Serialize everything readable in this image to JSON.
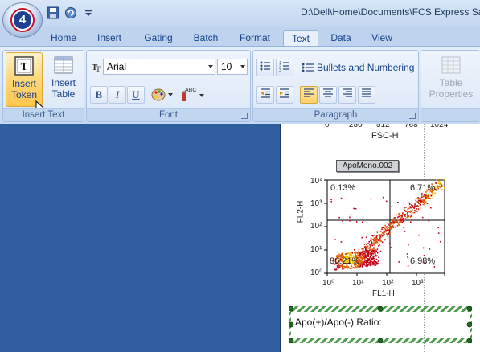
{
  "window": {
    "title": "D:\\Dell\\Home\\Documents\\FCS Express Sa"
  },
  "app_logo": {
    "text": "4"
  },
  "quick_access": {
    "items": [
      "save-icon",
      "undo-icon",
      "customize-dropdown-icon"
    ]
  },
  "tabs": [
    "Home",
    "Insert",
    "Gating",
    "Batch",
    "Format",
    "Text",
    "Data",
    "View"
  ],
  "active_tab": "Text",
  "ribbon": {
    "insert_text": {
      "label": "Insert Text",
      "insert_token": "Insert Token",
      "insert_token_line1": "Insert",
      "insert_token_line2": "Token",
      "insert_table_line1": "Insert",
      "insert_table_line2": "Table"
    },
    "font": {
      "label": "Font",
      "font_name": "Arial",
      "font_size": "10",
      "bold": "B",
      "italic": "I",
      "underline": "U"
    },
    "paragraph": {
      "label": "Paragraph",
      "bullets_numbering": "Bullets and Numbering"
    },
    "table_properties": {
      "line1": "Table",
      "line2": "Properties"
    }
  },
  "document": {
    "top_axis_label": "FSC-H",
    "top_axis_ticks": [
      "0",
      "250",
      "512",
      "768",
      "1024"
    ],
    "plot": {
      "title": "ApoMono.002",
      "x_label": "FL1-H",
      "y_label": "FL2-H",
      "x_ticks": [
        "10⁰",
        "10¹",
        "10²",
        "10³"
      ],
      "y_ticks": [
        "10⁴",
        "10³",
        "10²",
        "10¹",
        "10⁰"
      ],
      "quadrants": {
        "upper_left": "0.13%",
        "upper_right": "6.71%",
        "lower_left": "86.21%",
        "lower_right": "6.98%"
      }
    },
    "textbox": {
      "text": "Apo(+)/Apo(-) Ratio:"
    }
  },
  "colors": {
    "workspace": "#2f5f9e",
    "ribbon": "#d4e3f6",
    "highlight": "#ffd77a",
    "selection_hatch": "#2e8b2e"
  }
}
